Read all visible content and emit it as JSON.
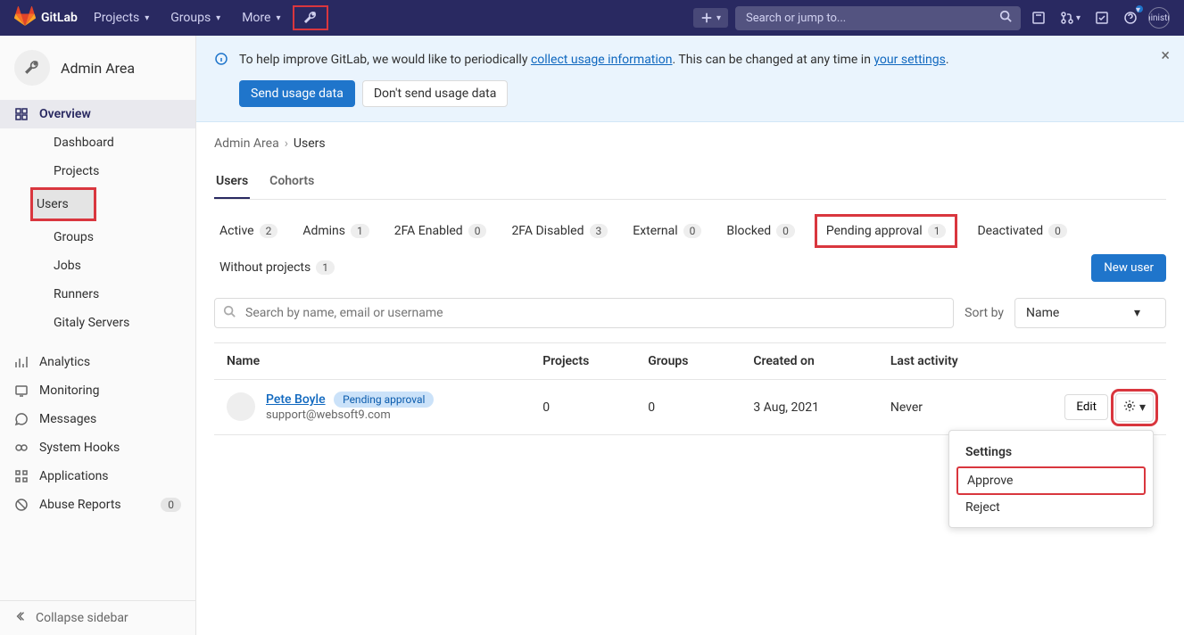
{
  "brand": "GitLab",
  "nav": {
    "projects": "Projects",
    "groups": "Groups",
    "more": "More",
    "search_placeholder": "Search or jump to...",
    "user": "Administrator"
  },
  "sidebar": {
    "title": "Admin Area",
    "overview": "Overview",
    "sub": {
      "dashboard": "Dashboard",
      "projects": "Projects",
      "users": "Users",
      "groups": "Groups",
      "jobs": "Jobs",
      "runners": "Runners",
      "gitaly": "Gitaly Servers"
    },
    "analytics": "Analytics",
    "monitoring": "Monitoring",
    "messages": "Messages",
    "system_hooks": "System Hooks",
    "applications": "Applications",
    "abuse_reports": "Abuse Reports",
    "abuse_count": "0",
    "collapse": "Collapse sidebar"
  },
  "banner": {
    "text_before": "To help improve GitLab, we would like to periodically ",
    "link1": "collect usage information",
    "text_mid": ". This can be changed at any time in ",
    "link2": "your settings",
    "text_after": ".",
    "send": "Send usage data",
    "dont_send": "Don't send usage data"
  },
  "breadcrumb": {
    "admin": "Admin Area",
    "users": "Users"
  },
  "tabs": {
    "users": "Users",
    "cohorts": "Cohorts"
  },
  "filters": {
    "active": {
      "label": "Active",
      "count": "2"
    },
    "admins": {
      "label": "Admins",
      "count": "1"
    },
    "tfa_enabled": {
      "label": "2FA Enabled",
      "count": "0"
    },
    "tfa_disabled": {
      "label": "2FA Disabled",
      "count": "3"
    },
    "external": {
      "label": "External",
      "count": "0"
    },
    "blocked": {
      "label": "Blocked",
      "count": "0"
    },
    "pending": {
      "label": "Pending approval",
      "count": "1"
    },
    "deactivated": {
      "label": "Deactivated",
      "count": "0"
    },
    "without_projects": {
      "label": "Without projects",
      "count": "1"
    }
  },
  "new_user": "New user",
  "search_placeholder": "Search by name, email or username",
  "sort_by_label": "Sort by",
  "sort_value": "Name",
  "columns": {
    "name": "Name",
    "projects": "Projects",
    "groups": "Groups",
    "created": "Created on",
    "activity": "Last activity"
  },
  "row": {
    "name": "Pete Boyle",
    "badge": "Pending approval",
    "email": "support@websoft9.com",
    "projects": "0",
    "groups": "0",
    "created": "3 Aug, 2021",
    "activity": "Never",
    "edit": "Edit"
  },
  "dropdown": {
    "title": "Settings",
    "approve": "Approve",
    "reject": "Reject"
  }
}
